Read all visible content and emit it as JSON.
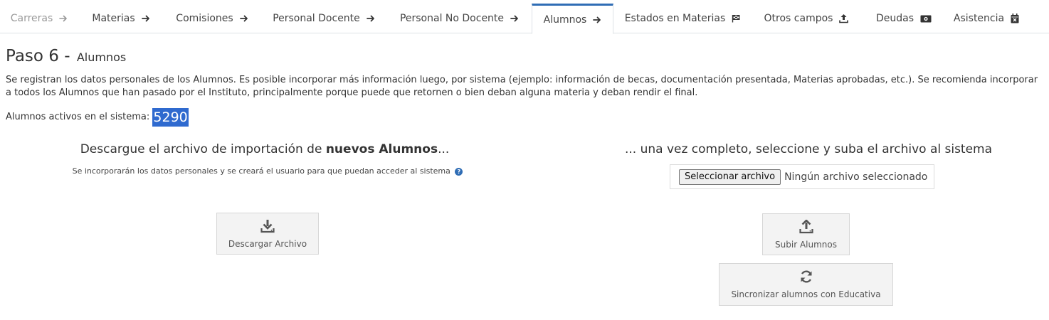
{
  "tabs": [
    {
      "label": "Carreras",
      "icon": "arrow-right-icon",
      "state": "disabled"
    },
    {
      "label": "Materias",
      "icon": "arrow-right-icon",
      "state": "normal"
    },
    {
      "label": "Comisiones",
      "icon": "arrow-right-icon",
      "state": "normal"
    },
    {
      "label": "Personal Docente",
      "icon": "arrow-right-icon",
      "state": "normal"
    },
    {
      "label": "Personal No Docente",
      "icon": "arrow-right-icon",
      "state": "normal"
    },
    {
      "label": "Alumnos",
      "icon": "arrow-right-icon",
      "state": "active"
    },
    {
      "label": "Estados en Materias",
      "icon": "flag-checkered-icon",
      "state": "normal"
    },
    {
      "label": "Otros campos",
      "icon": "upload-icon",
      "state": "normal"
    },
    {
      "label": "Deudas",
      "icon": "money-bill-icon",
      "state": "normal"
    },
    {
      "label": "Asistencia",
      "icon": "calendar-times-icon",
      "state": "normal"
    }
  ],
  "page": {
    "title": "Paso 6 -",
    "subtitle": "Alumnos",
    "description": "Se registran los datos personales de los Alumnos. Es posible incorporar más información luego, por sistema (ejemplo: información de becas, documentación presentada, Materias aprobadas, etc.). Se recomienda incorporar a todos los Alumnos que han pasado por el Instituto, principalmente porque puede que retornen o bien deban alguna materia y deban rendir el final.",
    "active_label": "Alumnos activos en el sistema:",
    "active_count": "5290"
  },
  "download": {
    "heading_prefix": "Descargue el archivo de importación de",
    "heading_bold": "nuevos Alumnos",
    "heading_suffix": "...",
    "subtext": "Se incorporarán los datos personales y se creará el usuario para que puedan acceder al sistema",
    "help_glyph": "?",
    "button_label": "Descargar Archivo"
  },
  "upload": {
    "heading": "... una vez completo, seleccione y suba el archivo al sistema",
    "file_button": "Seleccionar archivo",
    "file_status": "Ningún archivo seleccionado",
    "upload_button": "Subir Alumnos",
    "sync_button": "Sincronizar alumnos con Educativa"
  },
  "colors": {
    "accent": "#2f6db5",
    "highlight": "#2f6acf"
  }
}
